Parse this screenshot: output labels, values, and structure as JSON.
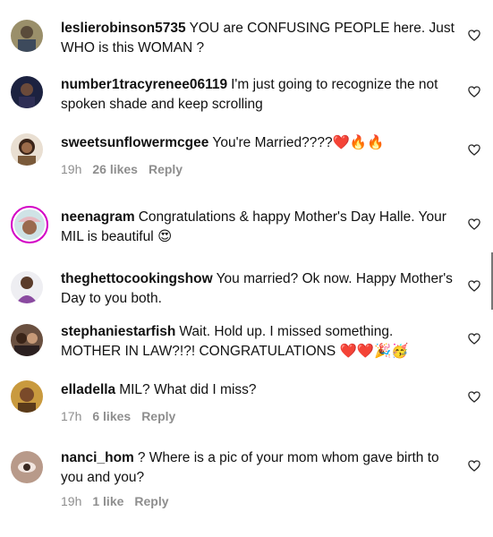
{
  "comments": [
    {
      "username": "leslierobinson5735",
      "text": "YOU are CONFUSING PEOPLE here. Just WHO is this WOMAN ?",
      "time": "",
      "likes": "",
      "reply": ""
    },
    {
      "username": "number1tracyrenee06119",
      "text": "I'm just going to recognize the not spoken shade and keep scrolling",
      "time": "",
      "likes": "",
      "reply": ""
    },
    {
      "username": "sweetsunflowermcgee",
      "text": "You're Married????❤️🔥🔥",
      "time": "19h",
      "likes": "26 likes",
      "reply": "Reply"
    },
    {
      "username": "neenagram",
      "text": "Congratulations & happy Mother's Day Halle. Your MIL is beautiful 😍",
      "time": "",
      "likes": "",
      "reply": ""
    },
    {
      "username": "theghettocookingshow",
      "text": "You married? Ok now. Happy Mother's Day to you both.",
      "time": "",
      "likes": "",
      "reply": ""
    },
    {
      "username": "stephaniestarfish",
      "text": "Wait. Hold up. I missed something. MOTHER IN LAW?!?! CONGRATULATIONS ❤️❤️🎉🥳",
      "time": "",
      "likes": "",
      "reply": ""
    },
    {
      "username": "elladella",
      "text": "MIL? What did I miss?",
      "time": "17h",
      "likes": "6 likes",
      "reply": "Reply"
    },
    {
      "username": "nanci_hom",
      "text": "? Where is a pic of your mom whom gave birth to you and you?",
      "time": "19h",
      "likes": "1 like",
      "reply": "Reply"
    }
  ],
  "icons": {
    "like": "heart-outline-icon"
  },
  "colors": {
    "text": "#111111",
    "meta": "#8e8e8e",
    "story_ring": "#d300c5"
  }
}
